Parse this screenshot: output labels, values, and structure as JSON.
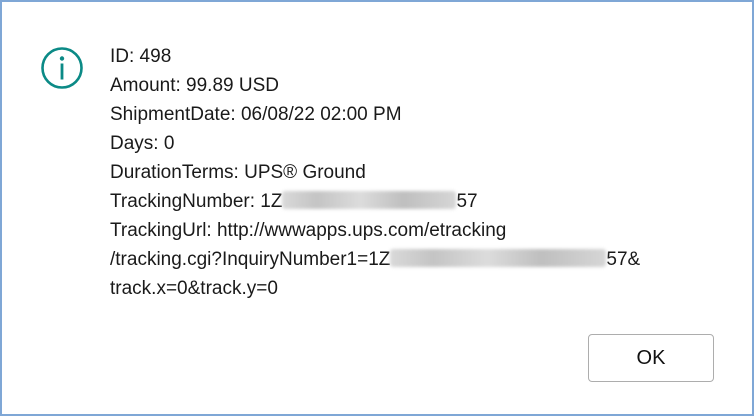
{
  "dialog": {
    "icon": "info-icon",
    "accent_color": "#0b8a86",
    "lines": {
      "id": "ID: 498",
      "amount": "Amount: 99.89 USD",
      "shipment_date": "ShipmentDate: 06/08/22 02:00 PM",
      "days": "Days: 0",
      "duration_terms": "DurationTerms: UPS® Ground",
      "tracking_number_prefix": "TrackingNumber: 1Z",
      "tracking_number_suffix": "57",
      "tracking_url_line1": "TrackingUrl: http://wwwapps.ups.com/etracking",
      "tracking_url_line2_prefix": "/tracking.cgi?InquiryNumber1=1Z",
      "tracking_url_line2_suffix": "57&",
      "tracking_url_line3": "track.x=0&track.y=0"
    },
    "ok_label": "OK"
  }
}
